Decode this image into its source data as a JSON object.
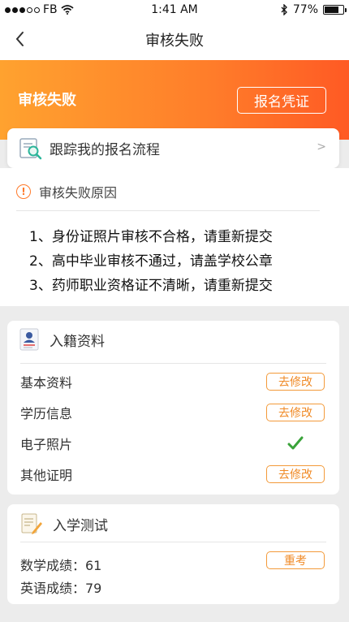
{
  "status_bar": {
    "carrier": "FB",
    "time": "1:41 AM",
    "battery": "77%",
    "battery_level": 0.77
  },
  "nav": {
    "title": "审核失败",
    "back_icon": "chevron-left-icon"
  },
  "banner": {
    "title": "审核失败",
    "button_label": "报名凭证",
    "colors": [
      "#ffa22f",
      "#ff5a24"
    ]
  },
  "track": {
    "label": "跟踪我的报名流程",
    "arrow": ">"
  },
  "reason": {
    "title": "审核失败原因",
    "items": [
      "1、身份证照片审核不合格，请重新提交",
      "2、高中毕业审核不通过，请盖学校公章",
      "3、药师职业资格证不清晰，请重新提交"
    ]
  },
  "enrollment": {
    "title": "入籍资料",
    "rows": [
      {
        "label": "基本资料",
        "action": "去修改"
      },
      {
        "label": "学历信息",
        "action": "去修改"
      },
      {
        "label": "电子照片",
        "status": "check-icon"
      },
      {
        "label": "其他证明",
        "action": "去修改"
      }
    ]
  },
  "entrance_test": {
    "title": "入学测试",
    "math": "数学成绩：61",
    "english": "英语成绩：79",
    "action": "重考"
  },
  "colors": {
    "accent": "#f08a26",
    "check": "#3aa33a"
  }
}
